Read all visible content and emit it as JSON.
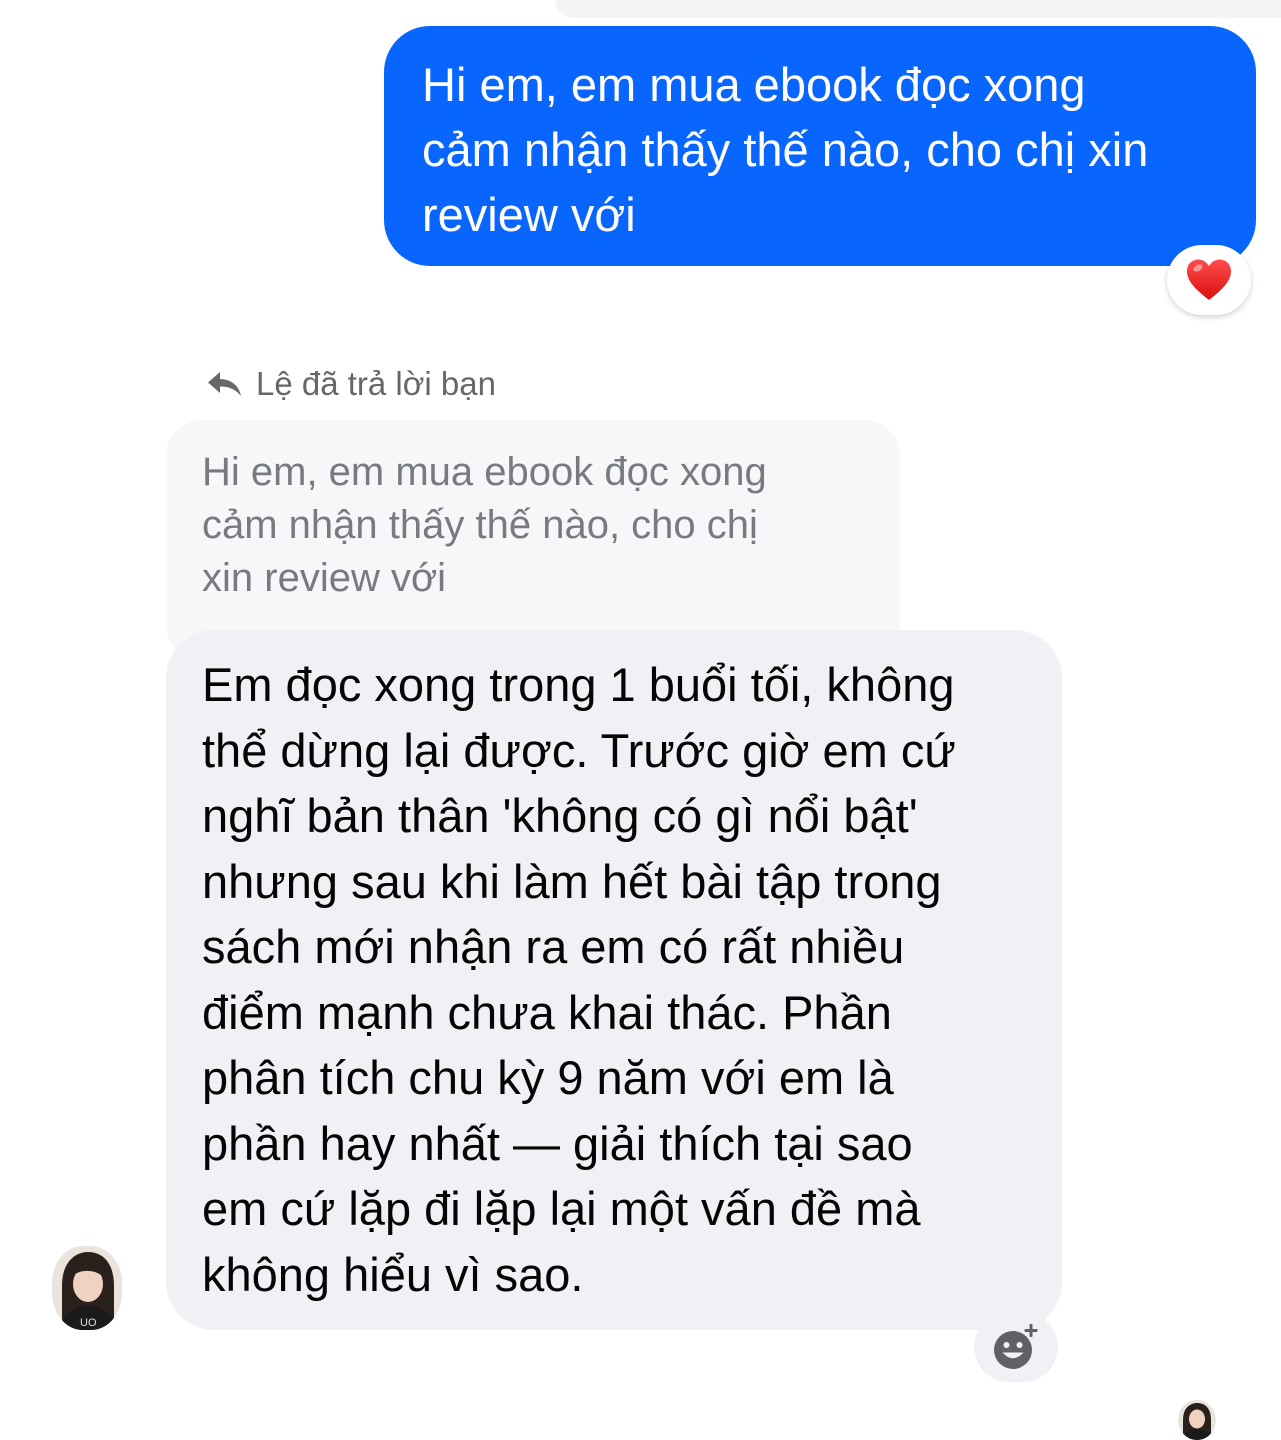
{
  "sent_message": {
    "lines": [
      "Hi em, em mua ebook đọc xong",
      "cảm nhận thấy thế nào, cho chị xin",
      "review với"
    ],
    "reaction": "heart",
    "bubble_color": "#0866ff"
  },
  "reply_context": {
    "header": "Lệ đã trả lời bạn",
    "quoted_lines": [
      "Hi em, em mua ebook đọc xong",
      "cảm nhận thấy thế nào, cho chị",
      "xin review với"
    ]
  },
  "received_message": {
    "lines": [
      "Em đọc xong trong 1 buổi tối, không",
      "thể dừng lại được. Trước giờ em cứ",
      "nghĩ bản thân 'không có gì nổi bật'",
      "nhưng sau khi làm hết bài tập trong",
      "sách mới nhận ra em có rất nhiều",
      "điểm mạnh chưa khai thác. Phần",
      "phân tích chu kỳ 9 năm với em là",
      "phần hay nhất — giải thích tại sao",
      "em cứ lặp đi lặp lại một vấn đề mà",
      "không hiểu vì sao."
    ],
    "bubble_color": "#f0f0f5"
  },
  "icons": {
    "reaction": "heart-icon",
    "reply": "reply-arrow-icon",
    "add_reaction": "add-reaction-icon",
    "avatar": "sender-avatar",
    "read_receipt": "read-receipt-avatar"
  }
}
